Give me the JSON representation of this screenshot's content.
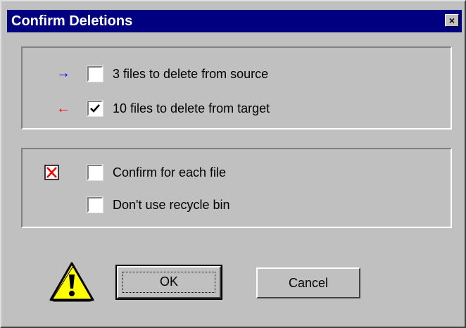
{
  "window": {
    "title": "Confirm Deletions",
    "close_label": "×"
  },
  "direction_group": {
    "items": [
      {
        "arrow": "→",
        "arrow_color": "#0000ff",
        "label": "3 files to delete from source",
        "checked": false
      },
      {
        "arrow": "←",
        "arrow_color": "#ff0000",
        "label": "10 files to delete from target",
        "checked": true
      }
    ]
  },
  "options_group": {
    "items": [
      {
        "label": "Confirm for each file",
        "checked": false
      },
      {
        "label": "Don't use recycle bin",
        "checked": false
      }
    ]
  },
  "buttons": {
    "ok_label": "OK",
    "cancel_label": "Cancel"
  },
  "icons": {
    "delete": "delete-x-icon",
    "warning": "warning-icon"
  }
}
